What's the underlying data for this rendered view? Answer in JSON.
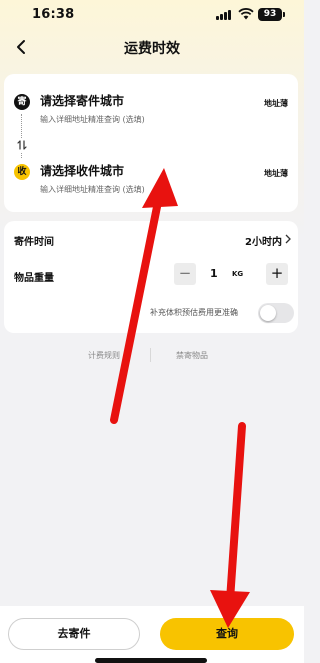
{
  "status_bar": {
    "time": "16:38",
    "battery": "93"
  },
  "nav": {
    "title": "运费时效"
  },
  "sender": {
    "icon_text": "寄",
    "title": "请选择寄件城市",
    "subtitle": "输入详细地址精准查询 (选填)",
    "address_book": "地址薄"
  },
  "receiver": {
    "icon_text": "收",
    "title": "请选择收件城市",
    "subtitle": "输入详细地址精准查询 (选填)",
    "address_book": "地址薄"
  },
  "options": {
    "time_label": "寄件时间",
    "time_value": "2小时内",
    "weight_label": "物品重量",
    "weight_value": "1",
    "weight_unit": "KG",
    "minus": "−",
    "plus": "+",
    "volume_hint": "补充体积预估费用更准确",
    "volume_toggle_on": false
  },
  "links": {
    "rules": "计费规则",
    "forbidden": "禁寄物品"
  },
  "bottom": {
    "send_button": "去寄件",
    "query_button": "查询"
  },
  "colors": {
    "accent": "#f8c300",
    "annotation_arrow": "#e8120f"
  }
}
